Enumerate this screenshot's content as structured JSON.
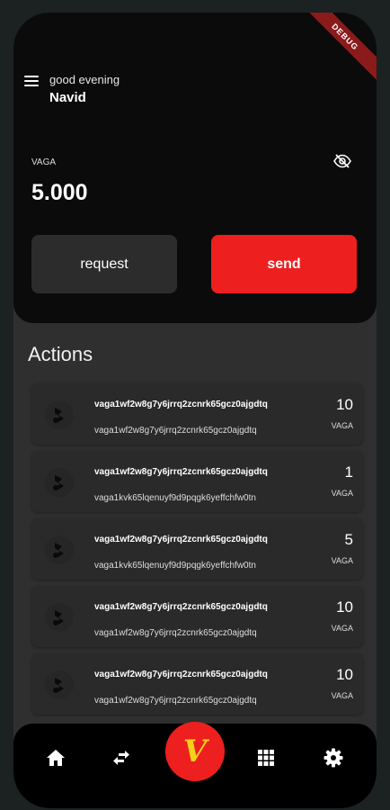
{
  "debug_banner": "DEBUG",
  "header": {
    "greeting": "good evening",
    "username": "Navid"
  },
  "wallet": {
    "coin": "VAGA",
    "balance": "5.000"
  },
  "buttons": {
    "request": "request",
    "send": "send"
  },
  "actions": {
    "title": "Actions",
    "items": [
      {
        "from": "vaga1wf2w8g7y6jrrq2zcnrk65gcz0ajgdtq",
        "to": "vaga1wf2w8g7y6jrrq2zcnrk65gcz0ajgdtq",
        "amount": "10",
        "unit": "VAGA"
      },
      {
        "from": "vaga1wf2w8g7y6jrrq2zcnrk65gcz0ajgdtq",
        "to": "vaga1kvk65lqenuyf9d9pqgk6yeffchfw0tn",
        "amount": "1",
        "unit": "VAGA"
      },
      {
        "from": "vaga1wf2w8g7y6jrrq2zcnrk65gcz0ajgdtq",
        "to": "vaga1kvk65lqenuyf9d9pqgk6yeffchfw0tn",
        "amount": "5",
        "unit": "VAGA"
      },
      {
        "from": "vaga1wf2w8g7y6jrrq2zcnrk65gcz0ajgdtq",
        "to": "vaga1wf2w8g7y6jrrq2zcnrk65gcz0ajgdtq",
        "amount": "10",
        "unit": "VAGA"
      },
      {
        "from": "vaga1wf2w8g7y6jrrq2zcnrk65gcz0ajgdtq",
        "to": "vaga1wf2w8g7y6jrrq2zcnrk65gcz0ajgdtq",
        "amount": "10",
        "unit": "VAGA"
      }
    ]
  },
  "nav": {
    "icons": [
      "home-icon",
      "transfer-icon",
      "vaga-logo",
      "grid-icon",
      "settings-icon"
    ],
    "logo_letter": "V"
  },
  "colors": {
    "accent": "#ee1f1f",
    "logo_letter": "#f5d21a",
    "background": "#2f2f2f",
    "card": "#0b0b0b"
  }
}
